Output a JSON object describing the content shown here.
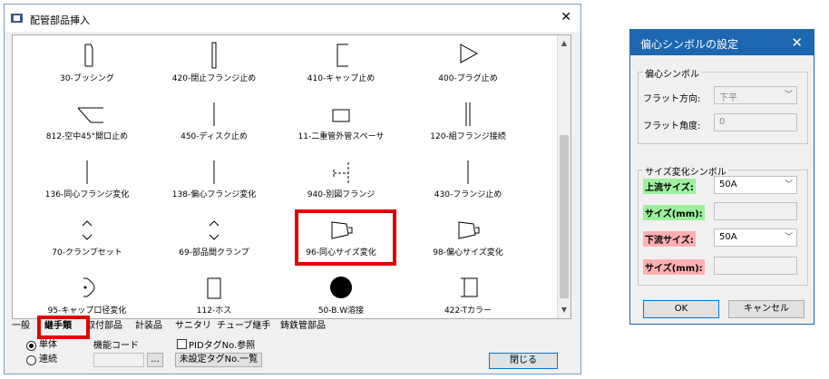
{
  "main": {
    "title": "配管部品挿入",
    "items": [
      {
        "label": "30-ブッシング",
        "symbol": "bushing"
      },
      {
        "label": "420-閉止フランジ止め",
        "symbol": "blind-flange"
      },
      {
        "label": "410-キャップ止め",
        "symbol": "cap"
      },
      {
        "label": "400-プラグ止め",
        "symbol": "plug"
      },
      {
        "label": "812-空中45°開口止め",
        "symbol": "open-45"
      },
      {
        "label": "450-ディスク止め",
        "symbol": "disk"
      },
      {
        "label": "11-二重管外管スペーサ",
        "symbol": "spacer"
      },
      {
        "label": "120-組フランジ接続",
        "symbol": "flange-pair"
      },
      {
        "label": "136-同心フランジ変化",
        "symbol": "conc-flange"
      },
      {
        "label": "138-偏心フランジ変化",
        "symbol": "ecc-flange"
      },
      {
        "label": "940-別図フランジ",
        "symbol": "other-flange"
      },
      {
        "label": "430-フランジ止め",
        "symbol": "flange-end"
      },
      {
        "label": "70-クランプセット",
        "symbol": "clamp-set"
      },
      {
        "label": "69-部品間クランプ",
        "symbol": "clamp"
      },
      {
        "label": "96-同心サイズ変化",
        "symbol": "conc-reducer"
      },
      {
        "label": "98-偏心サイズ変化",
        "symbol": "ecc-reducer"
      },
      {
        "label": "95-キャップ口径変化",
        "symbol": "cap-reducer"
      },
      {
        "label": "112-ホス",
        "symbol": "boss"
      },
      {
        "label": "50-B.W溶接",
        "symbol": "bw-weld"
      },
      {
        "label": "422-Tカラー",
        "symbol": "t-collar"
      }
    ],
    "tabs": [
      "一般",
      "継手類",
      "取付部品",
      "計装品",
      "サニタリ",
      "チューブ継手",
      "鋳鉄管部品"
    ],
    "radio_single": "単体",
    "radio_continuous": "連続",
    "function_code_label": "機能コード",
    "browse_btn": "...",
    "pid_check_label": "PIDタグNo.参照",
    "unset_tag_btn": "未設定タグNo.一覧",
    "close_btn": "閉じる",
    "accent_red": "#e00000"
  },
  "dialog": {
    "title": "偏心シンボルの設定",
    "group1_label": "偏心シンボル",
    "flat_dir_label": "フラット方向:",
    "flat_dir_value": "下平",
    "flat_angle_label": "フラット角度:",
    "flat_angle_value": "0",
    "group2_label": "サイズ変化シンボル",
    "upstream_size_label": "上流サイズ:",
    "upstream_size_value": "50A",
    "size_mm_label": "サイズ(mm):",
    "downstream_size_label": "下流サイズ:",
    "downstream_size_value": "50A",
    "size_mm_label2": "サイズ(mm):",
    "ok_btn": "OK",
    "cancel_btn": "キャンセル",
    "green": "#9ef09e",
    "pink": "#ffb0b0"
  }
}
